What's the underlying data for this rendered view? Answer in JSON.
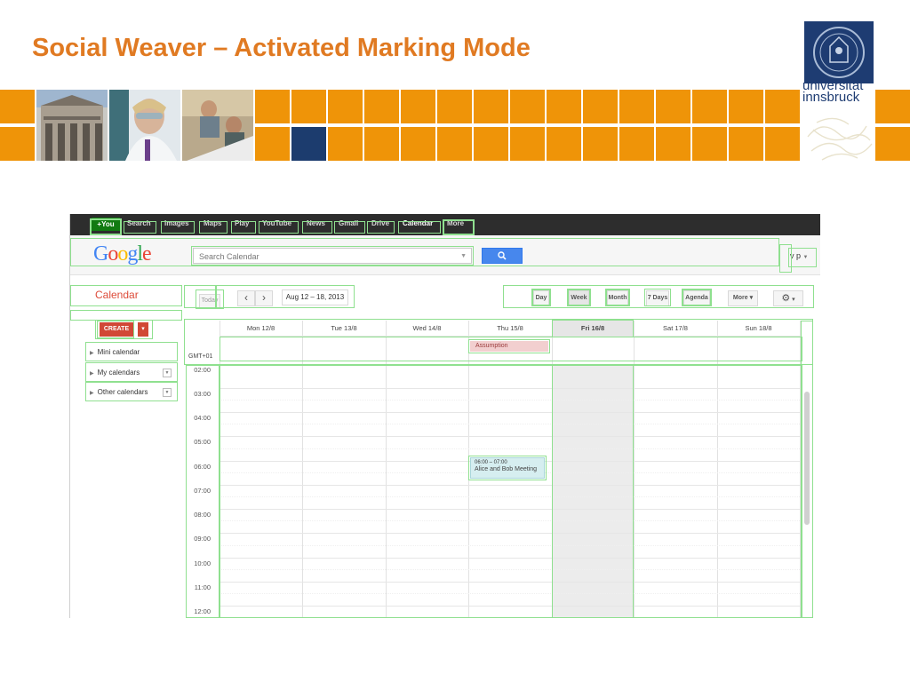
{
  "slide": {
    "title": "Social Weaver – Activated Marking Mode",
    "logo_line1": "universität",
    "logo_line2": "innsbruck",
    "accent_color": "#e07a22",
    "tile_color": "#ef9408"
  },
  "gbar": {
    "you": "+You",
    "items": [
      "Search",
      "Images",
      "Maps",
      "Play",
      "YouTube",
      "News",
      "Gmail",
      "Drive",
      "Calendar",
      "More"
    ],
    "active": "Calendar"
  },
  "header": {
    "logo": "Google",
    "search_placeholder": "Search Calendar",
    "search_icon": "search-icon",
    "user": "v p"
  },
  "toolbar": {
    "app_title": "Calendar",
    "today": "Today",
    "prev": "‹",
    "next": "›",
    "date_range": "Aug 12 – 18, 2013",
    "views": [
      "Day",
      "Week",
      "Month",
      "7 Days",
      "Agenda"
    ],
    "more": "More",
    "settings_icon": "gear-icon"
  },
  "sidebar": {
    "create": "CREATE",
    "items": [
      "Mini calendar",
      "My calendars",
      "Other calendars"
    ]
  },
  "calendar": {
    "timezone": "GMT+01",
    "days": [
      "Mon 12/8",
      "Tue 13/8",
      "Wed 14/8",
      "Thu 15/8",
      "Fri 16/8",
      "Sat 17/8",
      "Sun 18/8"
    ],
    "today": "Fri 16/8",
    "hours": [
      "02:00",
      "03:00",
      "04:00",
      "05:00",
      "06:00",
      "07:00",
      "08:00",
      "09:00",
      "10:00",
      "11:00",
      "12:00"
    ],
    "allday_event": "Assumption",
    "event": {
      "time": "06:00 – 07:00",
      "title": "Alice and Bob Meeting"
    }
  }
}
